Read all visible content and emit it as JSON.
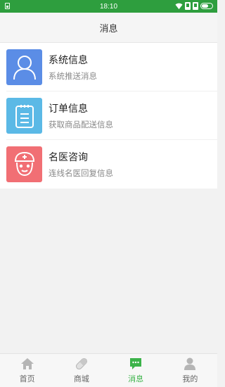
{
  "status_bar": {
    "time": "18:10"
  },
  "header": {
    "title": "消息"
  },
  "messages": [
    {
      "title": "系统信息",
      "subtitle": "系统推送消息",
      "color": "#5b8de6",
      "icon": "user-icon"
    },
    {
      "title": "订单信息",
      "subtitle": "获取商品配送信息",
      "color": "#5bb9e6",
      "icon": "clipboard-icon"
    },
    {
      "title": "名医咨询",
      "subtitle": "连线名医回复信息",
      "color": "#f16f74",
      "icon": "doctor-icon"
    }
  ],
  "tabbar": {
    "items": [
      {
        "label": "首页",
        "icon": "home-icon"
      },
      {
        "label": "商城",
        "icon": "pill-icon"
      },
      {
        "label": "消息",
        "icon": "chat-icon",
        "active": true
      },
      {
        "label": "我的",
        "icon": "person-icon"
      }
    ],
    "active_color": "#3cb34a"
  }
}
